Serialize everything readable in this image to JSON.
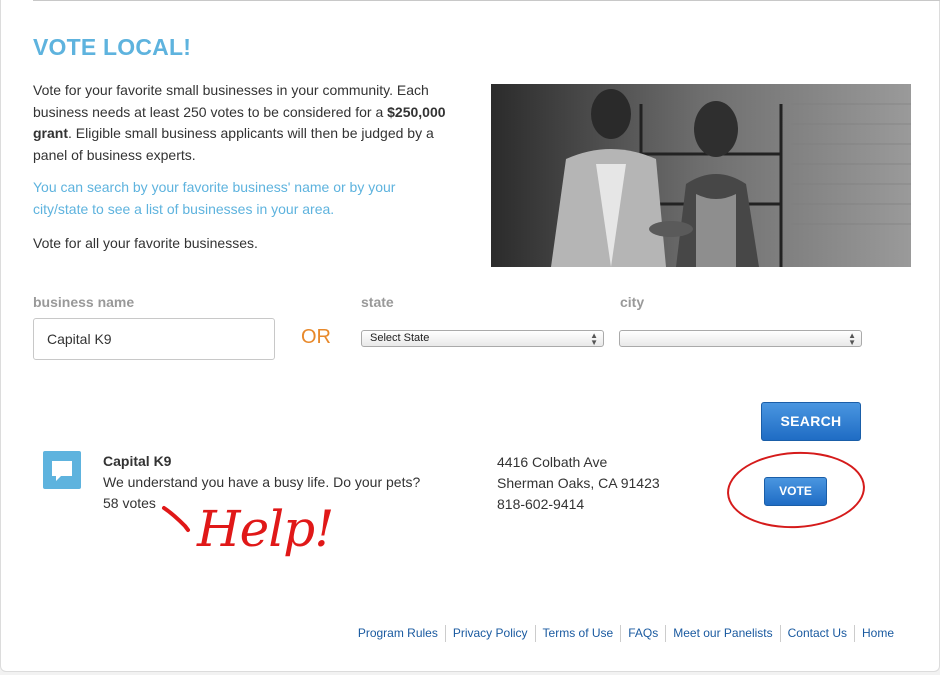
{
  "header": {
    "title": "VOTE LOCAL!"
  },
  "intro": {
    "part1": "Vote for your favorite small businesses in your community. Each business needs at least 250 votes to be considered for a ",
    "bold": "$250,000 grant",
    "part2": ". Eligible small business applicants will then be judged by a panel of business experts."
  },
  "search_hint": "You can search by your favorite business' name or by your city/state to see a list of businesses in your area.",
  "vote_all": "Vote for all your favorite businesses.",
  "form": {
    "business_label": "business name",
    "business_value": "Capital K9",
    "or_label": "OR",
    "state_label": "state",
    "state_selected": "Select State",
    "city_label": "city",
    "city_selected": "",
    "search_button": "SEARCH"
  },
  "result": {
    "icon": "speech-bubble-icon",
    "name": "Capital K9",
    "description": "We understand you have a busy life. Do your pets?",
    "votes": "58 votes",
    "address_line1": "4416 Colbath Ave",
    "address_line2": "Sherman Oaks, CA 91423",
    "phone": "818-602-9414",
    "vote_button": "VOTE"
  },
  "annotation": {
    "text": "Help!",
    "color": "#e01818"
  },
  "footer": {
    "links": [
      "Program Rules",
      "Privacy Policy",
      "Terms of Use",
      "FAQs",
      "Meet our Panelists",
      "Contact Us",
      "Home"
    ]
  },
  "colors": {
    "accent": "#5eb3de",
    "or": "#e8892b",
    "button": "#1f6cc4",
    "link": "#1a5aa0"
  }
}
